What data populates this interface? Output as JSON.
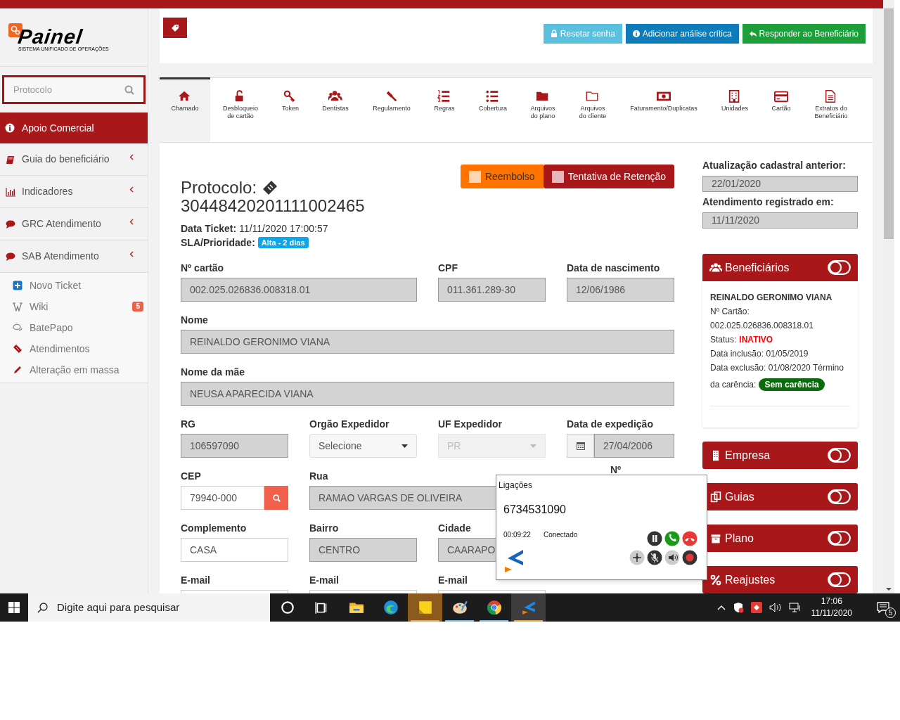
{
  "sidebar": {
    "logo": {
      "title": "Painel",
      "subtitle": "SISTEMA UNIFICADO DE OPERAÇÕES"
    },
    "search": {
      "placeholder": "Protocolo"
    },
    "menu": [
      {
        "label": "Apoio Comercial",
        "kind": "header",
        "selected": true
      },
      {
        "label": "Guia do beneficiário",
        "kind": "group",
        "selected": false
      },
      {
        "label": "Indicadores",
        "kind": "group",
        "selected": false
      },
      {
        "label": "GRC Atendimento",
        "kind": "group",
        "selected": false
      },
      {
        "label": "SAB Atendimento",
        "kind": "group",
        "selected": false,
        "children": [
          {
            "label": "Novo Ticket"
          },
          {
            "label": "Wiki",
            "badge": "5"
          },
          {
            "label": "BatePapo"
          },
          {
            "label": "Atendimentos"
          },
          {
            "label": "Alteração em massa"
          }
        ]
      }
    ]
  },
  "toolbar": {
    "buttons": [
      {
        "label": "Resetar senha",
        "color": "#5bc0de"
      },
      {
        "label": "Adicionar análise crítica",
        "color": "#0e7cb8"
      },
      {
        "label": "Responder ao Beneficiário",
        "color": "#1e9e3a"
      }
    ]
  },
  "tabs": [
    {
      "lines": [
        "Chamado"
      ],
      "selected": true
    },
    {
      "lines": [
        "Desbloqueio",
        "de cartão"
      ],
      "selected": false
    },
    {
      "lines": [
        "Token"
      ],
      "selected": false
    },
    {
      "lines": [
        "Dentistas"
      ],
      "selected": false
    },
    {
      "lines": [
        "Regulamento"
      ],
      "selected": false
    },
    {
      "lines": [
        "Regras"
      ],
      "selected": false
    },
    {
      "lines": [
        "Cobertura"
      ],
      "selected": false
    },
    {
      "lines": [
        "Arquivos",
        "do plano"
      ],
      "selected": false
    },
    {
      "lines": [
        "Arquivos",
        "do cliente"
      ],
      "selected": false
    },
    {
      "lines": [
        "Faturamento/Duplicatas"
      ],
      "selected": false
    },
    {
      "lines": [
        "Unidades"
      ],
      "selected": false
    },
    {
      "lines": [
        "Cartão"
      ],
      "selected": false
    },
    {
      "lines": [
        "Extratos do",
        "Beneficiário"
      ],
      "selected": false
    }
  ],
  "ticket": {
    "title": "Protocolo:",
    "number": "30448420201111002465",
    "flags": [
      {
        "label": "Reembolso",
        "color": "#ff7400"
      },
      {
        "label": "Tentativa de Retenção",
        "color": "#a8181a"
      }
    ],
    "data_ticket": {
      "label": "Data Ticket:",
      "value": "11/11/2020 17:00:57"
    },
    "sla": {
      "label": "SLA/Prioridade:",
      "badge": "Alta - 2 dias"
    }
  },
  "form_rows": [
    [
      {
        "label": "Nº cartão",
        "value": "002.025.026836.008318.01",
        "kind": "readonly"
      },
      {
        "label": "CPF",
        "value": "011.361.289-30",
        "kind": "readonly"
      },
      {
        "label": "Data de nascimento",
        "value": "12/06/1986",
        "kind": "readonly"
      }
    ],
    [
      {
        "label": "Nome",
        "value": "REINALDO GERONIMO VIANA",
        "kind": "readonly"
      }
    ],
    [
      {
        "label": "Nome da mãe",
        "value": "NEUSA APARECIDA VIANA",
        "kind": "readonly"
      }
    ],
    [
      {
        "label": "RG",
        "value": "106597090",
        "kind": "readonly"
      },
      {
        "label": "Orgão Expedidor",
        "value": "Selecione",
        "kind": "select"
      },
      {
        "label": "UF Expedidor",
        "value": "PR",
        "kind": "disabled_select"
      },
      {
        "label": "Data de expedição",
        "value": "27/04/2006",
        "kind": "date"
      }
    ],
    [
      {
        "label": "CEP",
        "value": "79940-000",
        "kind": "cep"
      },
      {
        "label": "Rua",
        "value": "RAMAO VARGAS DE OLIVEIRA",
        "kind": "readonly"
      },
      {
        "label": "Nº",
        "kind": "label"
      }
    ],
    [
      {
        "label": "Complemento",
        "value": "CASA",
        "kind": "input"
      },
      {
        "label": "Bairro",
        "value": "CENTRO",
        "kind": "readonly"
      },
      {
        "label": "Cidade",
        "value": "CAARAPO",
        "kind": "readonly"
      }
    ],
    [
      {
        "label": "E-mail",
        "kind": "input"
      },
      {
        "label": "E-mail",
        "kind": "input"
      },
      {
        "label": "E-mail",
        "kind": "input"
      }
    ]
  ],
  "side_info": [
    {
      "label": "Atualização cadastral anterior:",
      "value": "22/01/2020"
    },
    {
      "label": "Atendimento registrado em:",
      "value": "11/11/2020"
    }
  ],
  "panels": [
    {
      "title": "Beneficiários",
      "body": {
        "name": "REINALDO GERONIMO VIANA",
        "lines": [
          "Nº Cartão:",
          "002.025.026836.008318.01"
        ],
        "status_label": "Status:",
        "status": "INATIVO",
        "lines2": [
          "Data inclusão: 01/05/2019",
          "Data exclusão: 01/08/2020 Término"
        ],
        "carencia_label": "da carência:",
        "carencia": "Sem carência"
      }
    },
    {
      "title": "Empresa"
    },
    {
      "title": "Guias"
    },
    {
      "title": "Plano"
    },
    {
      "title": "Reajustes"
    }
  ],
  "call_popup": {
    "title": "Ligações",
    "number": "6734531090",
    "timer": "00:09:22",
    "status": "Conectado"
  },
  "taskbar": {
    "search_placeholder": "Digite aqui para pesquisar",
    "apps": [
      {
        "active": false,
        "running": false
      },
      {
        "active": false,
        "running": false
      },
      {
        "active": false,
        "running": false
      },
      {
        "active": false,
        "running": false
      },
      {
        "active": true,
        "running": true
      },
      {
        "active": false,
        "running": true
      },
      {
        "active": false,
        "running": true
      },
      {
        "active": true,
        "running": true
      }
    ],
    "time": "17:06",
    "date": "11/11/2020",
    "notifications": "5"
  }
}
